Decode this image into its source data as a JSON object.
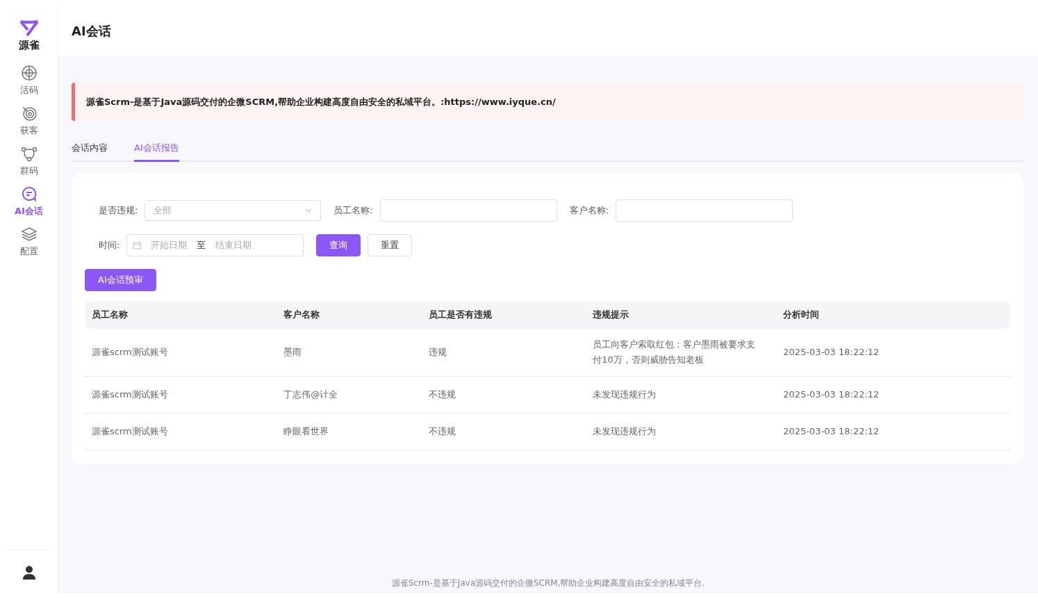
{
  "logo": {
    "text": "源雀"
  },
  "sidebar": {
    "items": [
      {
        "label": "活码",
        "selected": false
      },
      {
        "label": "获客",
        "selected": false
      },
      {
        "label": "群码",
        "selected": false
      },
      {
        "label": "AI会话",
        "selected": true
      },
      {
        "label": "配置",
        "selected": false
      }
    ]
  },
  "header": {
    "title": "AI会话"
  },
  "alert": {
    "text": "源雀Scrm-是基于Java源码交付的企微SCRM,帮助企业构建高度自由安全的私域平台。:https://www.iyque.cn/"
  },
  "tabs": [
    {
      "label": "会话内容",
      "selected": false
    },
    {
      "label": "AI会话报告",
      "selected": true
    }
  ],
  "filters": {
    "violation_label": "是否违规:",
    "violation_value": "全部",
    "employee_label": "员工名称:",
    "customer_label": "客户名称:",
    "time_label": "时间:",
    "start_placeholder": "开始日期",
    "range_sep": "至",
    "end_placeholder": "结束日期",
    "query_button": "查询",
    "reset_button": "重置"
  },
  "action_button": "AI会话预审",
  "table": {
    "columns": [
      "员工名称",
      "客户名称",
      "员工是否有违规",
      "违规提示",
      "分析时间"
    ],
    "rows": [
      [
        "源雀scrm测试账号",
        "墨雨",
        "违规",
        "员工向客户索取红包：客户墨雨被要求支付10万，否则威胁告知老板",
        "2025-03-03 18:22:12"
      ],
      [
        "源雀scrm测试账号",
        "丁志伟@计全",
        "不违规",
        "未发现违规行为",
        "2025-03-03 18:22:12"
      ],
      [
        "源雀scrm测试账号",
        "睁眼看世界",
        "不违规",
        "未发现违规行为",
        "2025-03-03 18:22:12"
      ]
    ]
  },
  "footer": {
    "text": "源雀Scrm-是基于Java源码交付的企微SCRM,帮助企业构建高度自由安全的私域平台."
  }
}
